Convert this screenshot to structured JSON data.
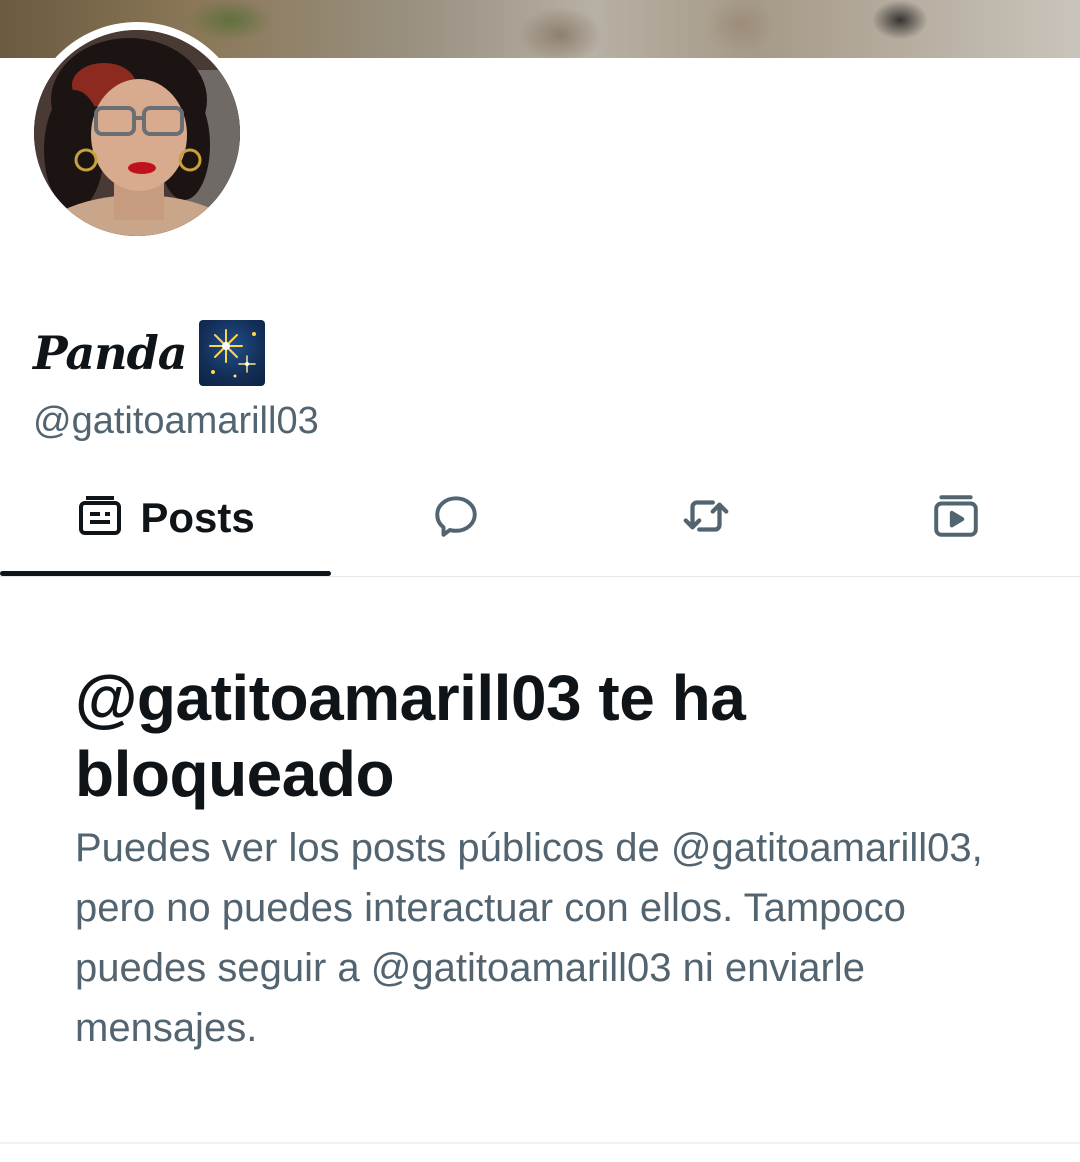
{
  "profile": {
    "display_name": "Panda",
    "name_emoji": "fireworks-emoji",
    "handle": "@gatitoamarill03"
  },
  "tabs": [
    {
      "label": "Posts",
      "icon": "posts-icon",
      "selected": true
    },
    {
      "label": "",
      "icon": "replies-icon",
      "selected": false
    },
    {
      "label": "",
      "icon": "reposts-icon",
      "selected": false
    },
    {
      "label": "",
      "icon": "media-icon",
      "selected": false
    }
  ],
  "blocked": {
    "title": "@gatitoamarill03 te ha bloqueado",
    "description": "Puedes ver los posts públicos de @gatitoamarill03, pero no puedes interactuar con ellos. Tampoco puedes seguir a @gatitoamarill03 ni enviarle mensajes."
  },
  "colors": {
    "text_primary": "#0f1419",
    "text_secondary": "#536471",
    "divider": "#eff3f4"
  }
}
